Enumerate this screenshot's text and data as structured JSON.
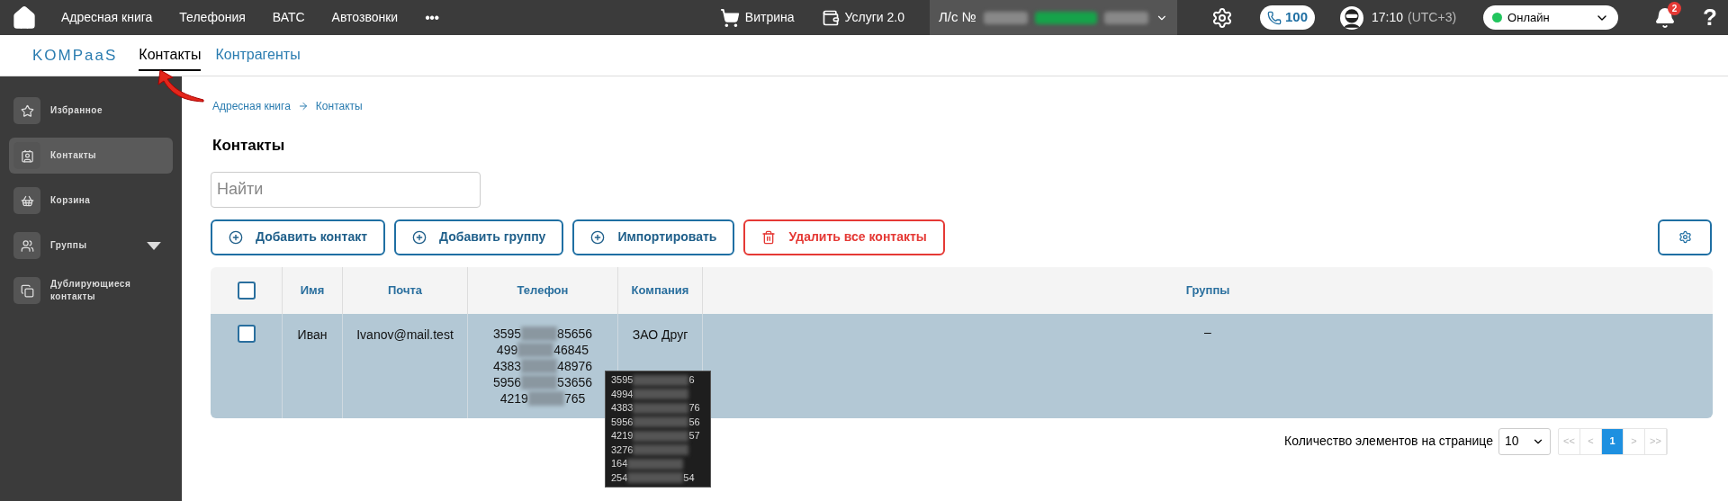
{
  "top_nav": {
    "items": [
      "Адресная книга",
      "Телефония",
      "ВАТС",
      "Автозвонки"
    ],
    "more": "•••",
    "showcase": "Витрина",
    "services": "Услуги 2.0",
    "account_label": "Л/с №",
    "calls_count": "100",
    "time": "17:10",
    "timezone": "(UTC+3)",
    "status": {
      "label": "Онлайн",
      "color": "#22c55e"
    },
    "notifications": "2",
    "help": "?"
  },
  "sub_nav": {
    "logo": "KOMPaaS",
    "tabs": [
      {
        "label": "Контакты",
        "selected": true
      },
      {
        "label": "Контрагенты",
        "selected": false
      }
    ]
  },
  "sidebar": {
    "items": [
      {
        "label": "Избранное",
        "selected": false,
        "expandable": false
      },
      {
        "label": "Контакты",
        "selected": true,
        "expandable": false
      },
      {
        "label": "Корзина",
        "selected": false,
        "expandable": false
      },
      {
        "label": "Группы",
        "selected": false,
        "expandable": true
      },
      {
        "label": "Дублирующиеся контакты",
        "selected": false,
        "expandable": false
      }
    ]
  },
  "breadcrumb": [
    "Адресная книга",
    "Контакты"
  ],
  "title": "Контакты",
  "search": {
    "placeholder": "Найти"
  },
  "actions": [
    {
      "label": "Добавить контакт",
      "kind": "primary"
    },
    {
      "label": "Добавить группу",
      "kind": "primary"
    },
    {
      "label": "Импортировать",
      "kind": "primary"
    },
    {
      "label": "Удалить все контакты",
      "kind": "danger"
    }
  ],
  "table": {
    "columns": [
      "Имя",
      "Почта",
      "Телефон",
      "Компания",
      "Группы"
    ],
    "all_checked": false,
    "rows": [
      {
        "checked": false,
        "name": "Иван",
        "email": "Ivanov@mail.test",
        "phones": [
          {
            "start": "3595",
            "end": "85656"
          },
          {
            "start": "499",
            "end": "46845"
          },
          {
            "start": "4383",
            "end": "48976"
          },
          {
            "start": "5956",
            "end": "53656"
          },
          {
            "start": "4219",
            "end": "765"
          }
        ],
        "company": "ЗАО Друг",
        "groups": "–"
      }
    ]
  },
  "tooltip": [
    {
      "start": "3595",
      "end": "6"
    },
    {
      "start": "4994"
    },
    {
      "start": "4383",
      "end": "76"
    },
    {
      "start": "5956",
      "end": "56"
    },
    {
      "start": "4219",
      "end": "57"
    },
    {
      "start": "3276"
    },
    {
      "start": "164"
    },
    {
      "start": "254",
      "end": "54"
    }
  ],
  "pagination": {
    "label": "Количество элементов на странице",
    "page_size": "10",
    "pages": [
      {
        "label": "<<",
        "kind": "nav"
      },
      {
        "label": "<",
        "kind": "nav"
      },
      {
        "label": "1",
        "kind": "page",
        "selected": true
      },
      {
        "label": ">",
        "kind": "nav"
      },
      {
        "label": ">>",
        "kind": "nav"
      }
    ]
  }
}
